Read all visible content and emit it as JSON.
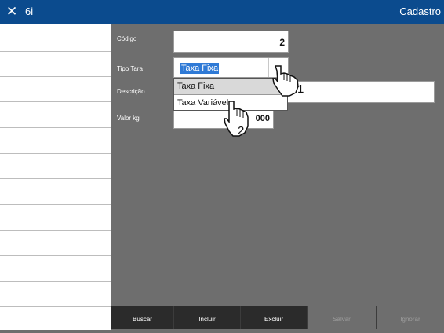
{
  "titlebar": {
    "close_icon": "close-icon",
    "app_label": "6i",
    "screen_title": "Cadastro"
  },
  "form": {
    "codigo_label": "Código",
    "codigo_value": "2",
    "tipo_tara_label": "Tipo Tara",
    "tipo_tara_value": "Taxa Fixa",
    "descricao_label": "Descrição",
    "descricao_value": "",
    "valor_kg_label": "Valor kg",
    "valor_kg_value": "000"
  },
  "dropdown": {
    "options": [
      "Taxa Fixa",
      "Taxa Variável"
    ]
  },
  "hints": {
    "step1": "1",
    "step2": "2"
  },
  "toolbar": {
    "buscar": "Buscar",
    "incluir": "Incluir",
    "excluir": "Excluir",
    "salvar": "Salvar",
    "ignorar": "Ignorar"
  },
  "colors": {
    "titlebar": "#0b4b8e",
    "panel": "#6e6e6e",
    "toolbar": "#2b2b2b",
    "selection": "#2f7ad6"
  }
}
